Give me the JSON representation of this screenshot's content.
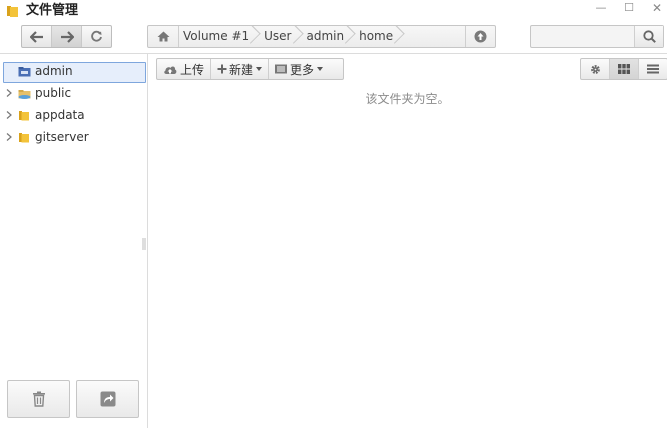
{
  "window": {
    "title": "文件管理",
    "controls": {
      "minimize": "—",
      "maximize": "☐",
      "close": "✕"
    }
  },
  "navigation": {
    "back_icon": "arrow-left-icon",
    "forward_icon": "arrow-right-icon",
    "refresh_icon": "refresh-icon"
  },
  "path": {
    "home_icon": "home-icon",
    "crumbs": [
      "Volume #1",
      "User",
      "admin",
      "home"
    ],
    "up_icon": "arrow-up-circle-icon"
  },
  "search": {
    "value": "",
    "placeholder": ""
  },
  "sidebar": {
    "items": [
      {
        "label": "admin",
        "icon": "user-folder-icon",
        "selected": true
      },
      {
        "label": "public",
        "icon": "shared-folder-icon"
      },
      {
        "label": "appdata",
        "icon": "folder-icon"
      },
      {
        "label": "gitserver",
        "icon": "folder-icon"
      }
    ],
    "trash_icon": "trash-icon",
    "share_icon": "share-icon"
  },
  "toolbar": {
    "upload_label": "上传",
    "new_label": "新建",
    "more_label": "更多"
  },
  "view": {
    "settings_icon": "gear-icon",
    "grid_icon": "grid-view-icon",
    "list_icon": "list-view-icon"
  },
  "main": {
    "empty_message": "该文件夹为空。"
  },
  "colors": {
    "selection_border": "#7ea6dd",
    "selection_fill": "#e6eefb",
    "folder": "#e8b730"
  }
}
